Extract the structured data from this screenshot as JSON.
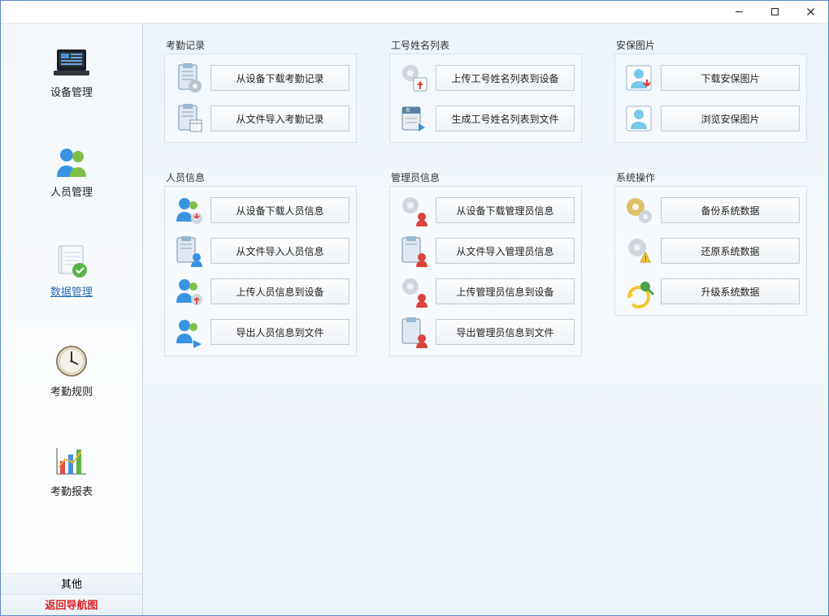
{
  "titlebar": {
    "min": "minimize",
    "max": "maximize",
    "close": "close"
  },
  "sidebar": {
    "items": [
      {
        "id": "device",
        "label": "设备管理"
      },
      {
        "id": "person",
        "label": "人员管理"
      },
      {
        "id": "data",
        "label": "数据管理"
      },
      {
        "id": "rule",
        "label": "考勤规则"
      },
      {
        "id": "report",
        "label": "考勤报表"
      }
    ],
    "active_index": 2,
    "footer_other": "其他",
    "footer_nav": "返回导航图"
  },
  "groups": {
    "attendance": {
      "title": "考勤记录",
      "actions": [
        {
          "label": "从设备下载考勤记录"
        },
        {
          "label": "从文件导入考勤记录"
        }
      ]
    },
    "idname": {
      "title": "工号姓名列表",
      "actions": [
        {
          "label": "上传工号姓名列表到设备"
        },
        {
          "label": "生成工号姓名列表到文件"
        }
      ]
    },
    "security": {
      "title": "安保图片",
      "actions": [
        {
          "label": "下载安保图片"
        },
        {
          "label": "浏览安保图片"
        }
      ]
    },
    "personinfo": {
      "title": "人员信息",
      "actions": [
        {
          "label": "从设备下载人员信息"
        },
        {
          "label": "从文件导入人员信息"
        },
        {
          "label": "上传人员信息到设备"
        },
        {
          "label": "导出人员信息到文件"
        }
      ]
    },
    "admininfo": {
      "title": "管理员信息",
      "actions": [
        {
          "label": "从设备下载管理员信息"
        },
        {
          "label": "从文件导入管理员信息"
        },
        {
          "label": "上传管理员信息到设备"
        },
        {
          "label": "导出管理员信息到文件"
        }
      ]
    },
    "sysop": {
      "title": "系统操作",
      "actions": [
        {
          "label": "备份系统数据"
        },
        {
          "label": "还原系统数据"
        },
        {
          "label": "升级系统数据"
        }
      ]
    }
  }
}
